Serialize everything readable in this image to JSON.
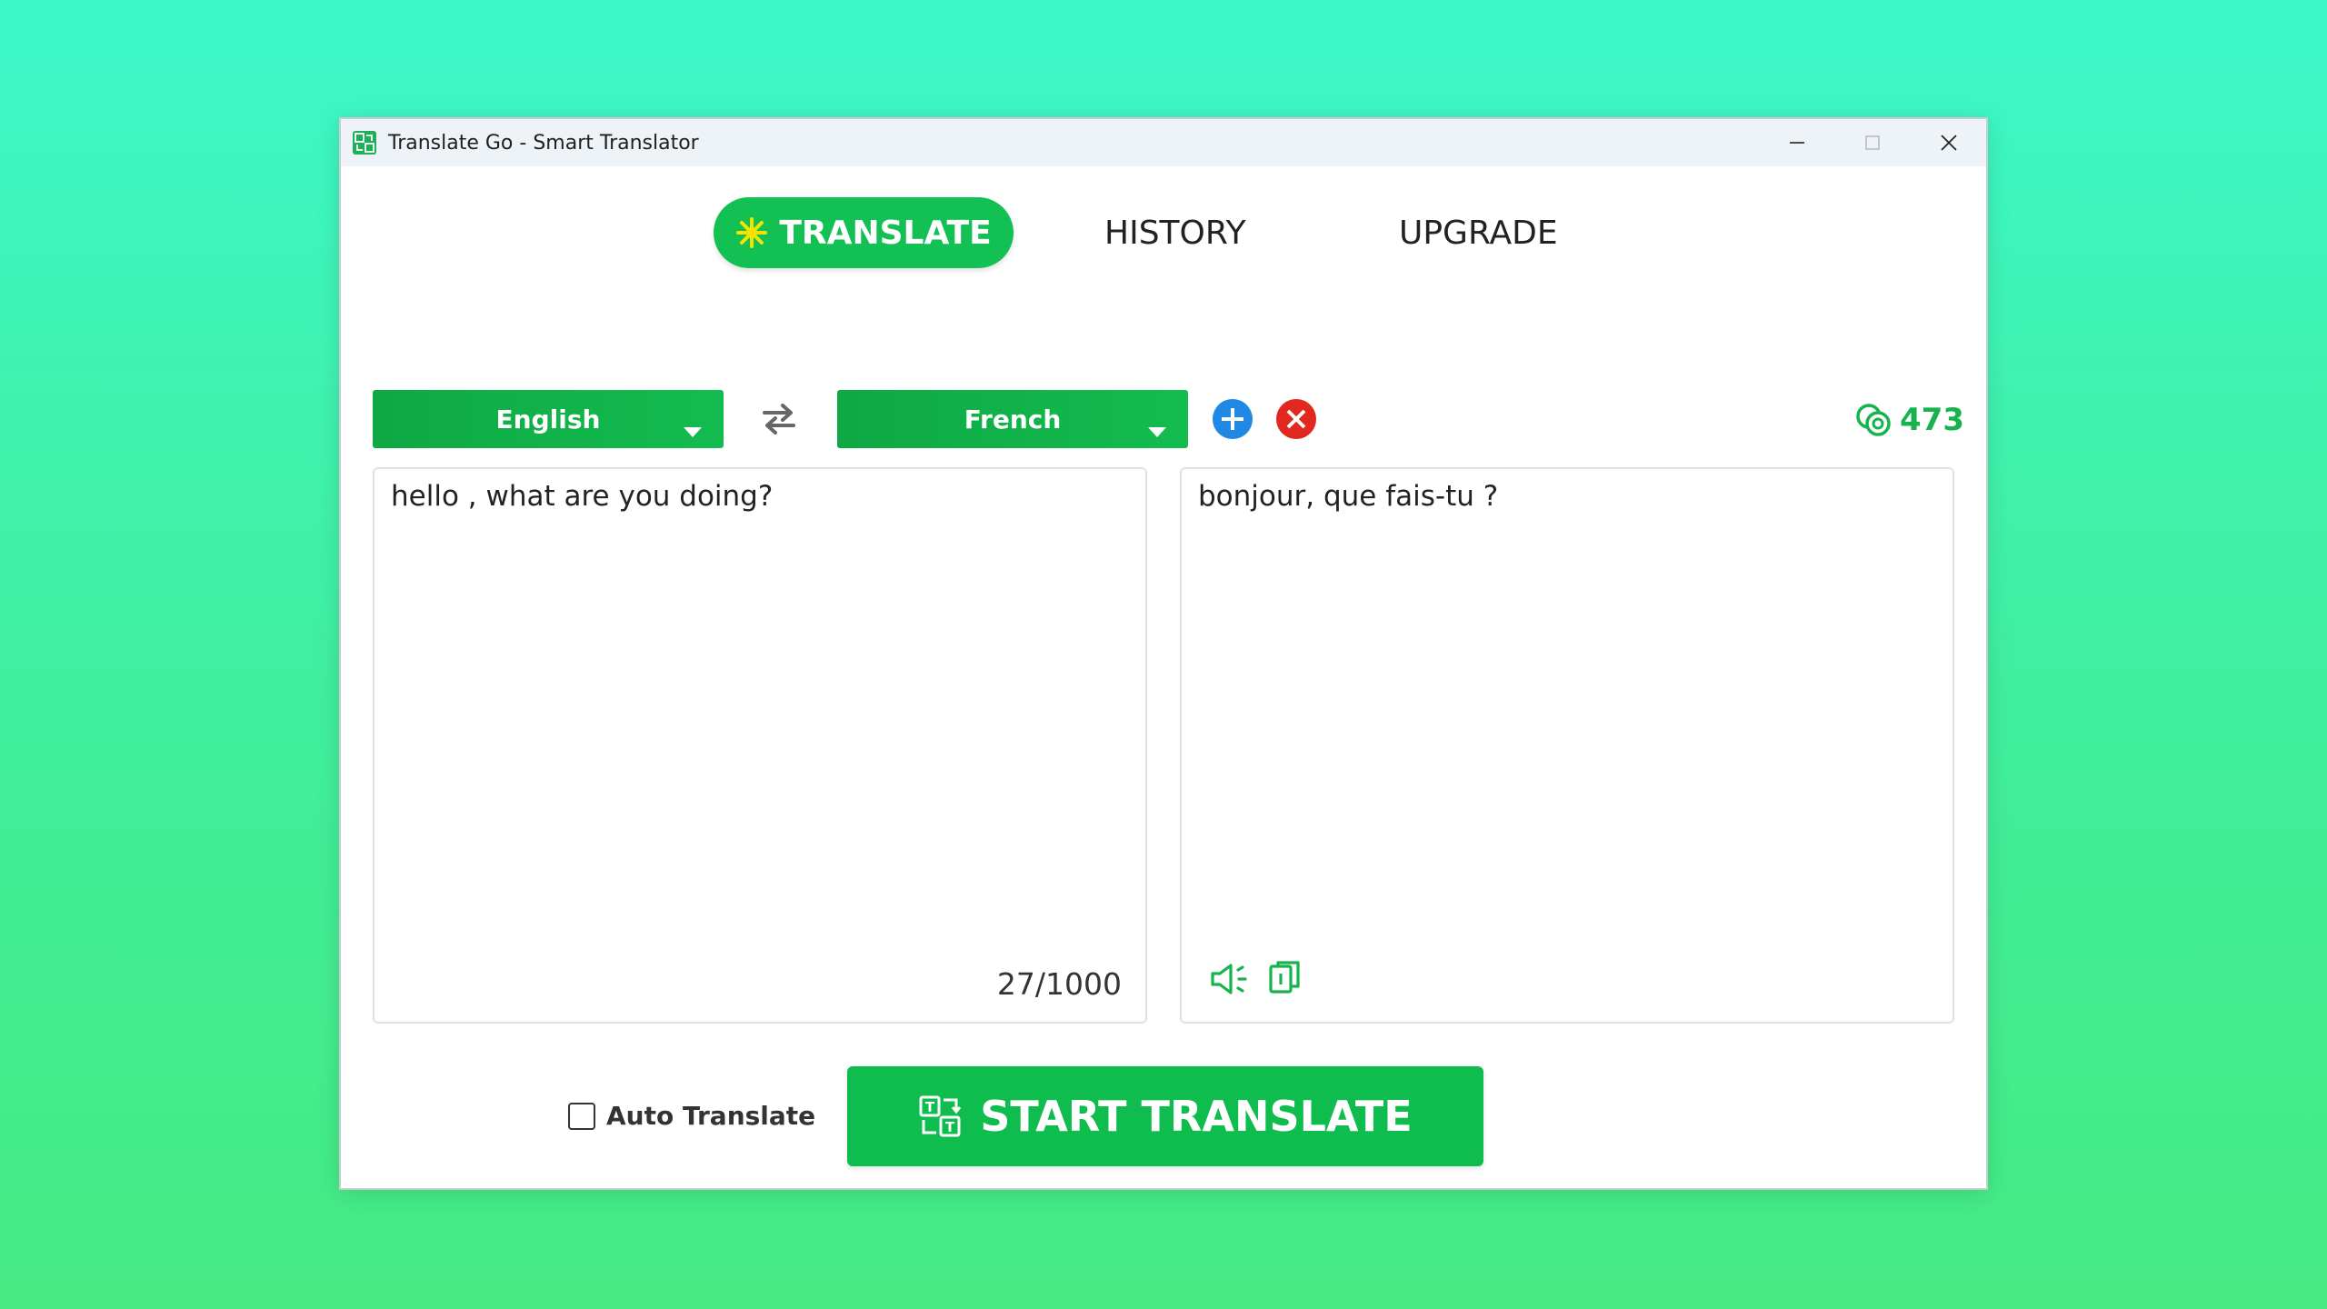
{
  "window": {
    "title": "Translate Go - Smart Translator"
  },
  "tabs": {
    "translate": "TRANSLATE",
    "history": "HISTORY",
    "upgrade": "UPGRADE",
    "active": "translate"
  },
  "languages": {
    "source": "English",
    "target": "French"
  },
  "credits": {
    "count": "473"
  },
  "source_panel": {
    "text": "hello , what are you doing?",
    "char_count": "27/1000"
  },
  "target_panel": {
    "text": "bonjour, que fais-tu ?"
  },
  "controls": {
    "auto_translate_label": "Auto Translate",
    "auto_translate_checked": false,
    "start_button": "START TRANSLATE"
  },
  "icons": {
    "app": "translate-app-icon",
    "minimize": "minimize-icon",
    "maximize": "maximize-icon",
    "close": "close-icon",
    "star": "sparkle-icon",
    "swap": "swap-languages-icon",
    "add": "add-language-icon",
    "clear": "clear-icon",
    "credits": "coins-icon",
    "speaker": "speaker-icon",
    "copy": "copy-icon",
    "translate": "translate-icon"
  },
  "colors": {
    "accent": "#12c053",
    "dark_accent": "#0fa844",
    "add_blue": "#1f88e5",
    "clear_red": "#e0281f",
    "star_yellow": "#f5e300"
  }
}
